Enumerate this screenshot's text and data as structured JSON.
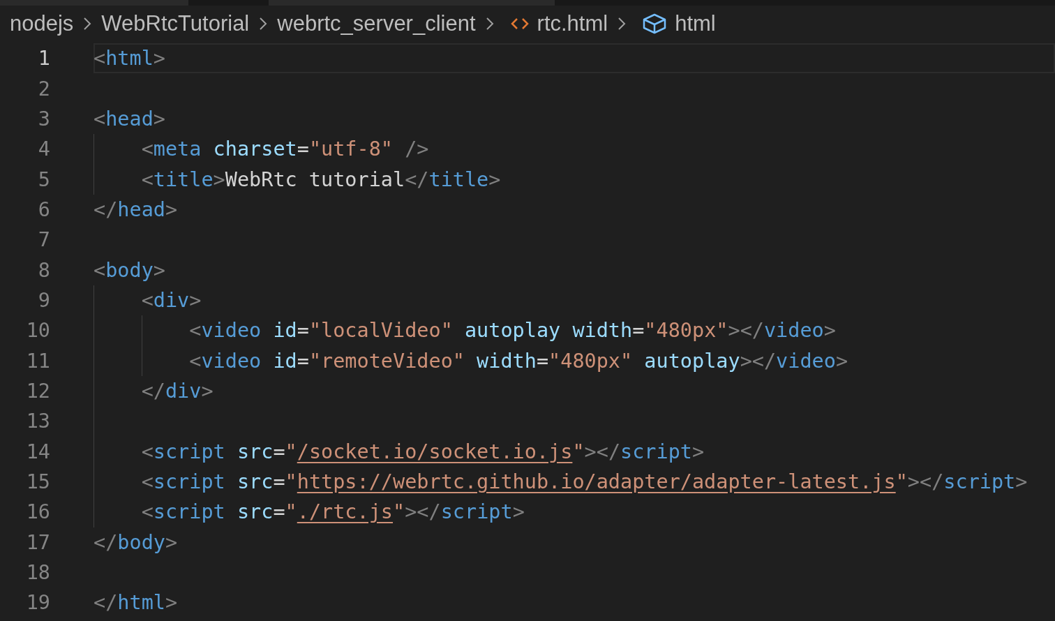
{
  "breadcrumbs": [
    {
      "kind": "folder",
      "label": "nodejs"
    },
    {
      "kind": "folder",
      "label": "WebRtcTutorial"
    },
    {
      "kind": "folder",
      "label": "webrtc_server_client"
    },
    {
      "kind": "file",
      "label": "rtc.html"
    },
    {
      "kind": "symbol",
      "label": "html"
    }
  ],
  "editor": {
    "lines": [
      {
        "number": "1",
        "current": true,
        "tokens": [
          {
            "kind": "punct",
            "text": "<"
          },
          {
            "kind": "tag",
            "text": "html"
          },
          {
            "kind": "punct",
            "text": ">"
          }
        ]
      },
      {
        "number": "2",
        "current": false
      },
      {
        "number": "3",
        "current": false,
        "tokens": [
          {
            "kind": "punct",
            "text": "<"
          },
          {
            "kind": "tag",
            "text": "head"
          },
          {
            "kind": "punct",
            "text": ">"
          }
        ]
      },
      {
        "number": "4",
        "current": false,
        "tokens": [
          {
            "kind": "punct",
            "text": "    <"
          },
          {
            "kind": "tag",
            "text": "meta"
          },
          {
            "kind": "attr",
            "text": " charset"
          },
          {
            "kind": "text",
            "text": "="
          },
          {
            "kind": "string",
            "text": "\"utf-8\""
          },
          {
            "kind": "punct",
            "text": " />"
          }
        ]
      },
      {
        "number": "5",
        "current": false,
        "tokens": [
          {
            "kind": "punct",
            "text": "    <"
          },
          {
            "kind": "tag",
            "text": "title"
          },
          {
            "kind": "punct",
            "text": ">"
          },
          {
            "kind": "text",
            "text": "WebRtc tutorial"
          },
          {
            "kind": "punct",
            "text": "</"
          },
          {
            "kind": "tag",
            "text": "title"
          },
          {
            "kind": "punct",
            "text": ">"
          }
        ]
      },
      {
        "number": "6",
        "current": false,
        "tokens": [
          {
            "kind": "punct",
            "text": "</"
          },
          {
            "kind": "tag",
            "text": "head"
          },
          {
            "kind": "punct",
            "text": ">"
          }
        ]
      },
      {
        "number": "7",
        "current": false
      },
      {
        "number": "8",
        "current": false,
        "tokens": [
          {
            "kind": "punct",
            "text": "<"
          },
          {
            "kind": "tag",
            "text": "body"
          },
          {
            "kind": "punct",
            "text": ">"
          }
        ]
      },
      {
        "number": "9",
        "current": false,
        "tokens": [
          {
            "kind": "punct",
            "text": "    <"
          },
          {
            "kind": "tag",
            "text": "div"
          },
          {
            "kind": "punct",
            "text": ">"
          }
        ]
      },
      {
        "number": "10",
        "current": false,
        "tokens": [
          {
            "kind": "punct",
            "text": "        <"
          },
          {
            "kind": "tag",
            "text": "video"
          },
          {
            "kind": "attr",
            "text": " id"
          },
          {
            "kind": "text",
            "text": "="
          },
          {
            "kind": "string",
            "text": "\"localVideo\""
          },
          {
            "kind": "attr",
            "text": " autoplay width"
          },
          {
            "kind": "text",
            "text": "="
          },
          {
            "kind": "string",
            "text": "\"480px\""
          },
          {
            "kind": "punct",
            "text": "></"
          },
          {
            "kind": "tag",
            "text": "video"
          },
          {
            "kind": "punct",
            "text": ">"
          }
        ]
      },
      {
        "number": "11",
        "current": false,
        "tokens": [
          {
            "kind": "punct",
            "text": "        <"
          },
          {
            "kind": "tag",
            "text": "video"
          },
          {
            "kind": "attr",
            "text": " id"
          },
          {
            "kind": "text",
            "text": "="
          },
          {
            "kind": "string",
            "text": "\"remoteVideo\""
          },
          {
            "kind": "attr",
            "text": " width"
          },
          {
            "kind": "text",
            "text": "="
          },
          {
            "kind": "string",
            "text": "\"480px\""
          },
          {
            "kind": "attr",
            "text": " autoplay"
          },
          {
            "kind": "punct",
            "text": "></"
          },
          {
            "kind": "tag",
            "text": "video"
          },
          {
            "kind": "punct",
            "text": ">"
          }
        ]
      },
      {
        "number": "12",
        "current": false,
        "tokens": [
          {
            "kind": "punct",
            "text": "    </"
          },
          {
            "kind": "tag",
            "text": "div"
          },
          {
            "kind": "punct",
            "text": ">"
          }
        ]
      },
      {
        "number": "13",
        "current": false
      },
      {
        "number": "14",
        "current": false,
        "tokens": [
          {
            "kind": "punct",
            "text": "    <"
          },
          {
            "kind": "tag",
            "text": "script"
          },
          {
            "kind": "attr",
            "text": " src"
          },
          {
            "kind": "text",
            "text": "="
          },
          {
            "kind": "string",
            "text": "\""
          },
          {
            "kind": "link",
            "text": "/socket.io/socket.io.js"
          },
          {
            "kind": "string",
            "text": "\""
          },
          {
            "kind": "punct",
            "text": "></"
          },
          {
            "kind": "tag",
            "text": "script"
          },
          {
            "kind": "punct",
            "text": ">"
          }
        ]
      },
      {
        "number": "15",
        "current": false,
        "tokens": [
          {
            "kind": "punct",
            "text": "    <"
          },
          {
            "kind": "tag",
            "text": "script"
          },
          {
            "kind": "attr",
            "text": " src"
          },
          {
            "kind": "text",
            "text": "="
          },
          {
            "kind": "string",
            "text": "\""
          },
          {
            "kind": "link",
            "text": "https://webrtc.github.io/adapter/adapter-latest.js"
          },
          {
            "kind": "string",
            "text": "\""
          },
          {
            "kind": "punct",
            "text": "></"
          },
          {
            "kind": "tag",
            "text": "script"
          },
          {
            "kind": "punct",
            "text": ">"
          }
        ]
      },
      {
        "number": "16",
        "current": false,
        "tokens": [
          {
            "kind": "punct",
            "text": "    <"
          },
          {
            "kind": "tag",
            "text": "script"
          },
          {
            "kind": "attr",
            "text": " src"
          },
          {
            "kind": "text",
            "text": "="
          },
          {
            "kind": "string",
            "text": "\""
          },
          {
            "kind": "link",
            "text": "./rtc.js"
          },
          {
            "kind": "string",
            "text": "\""
          },
          {
            "kind": "punct",
            "text": "></"
          },
          {
            "kind": "tag",
            "text": "script"
          },
          {
            "kind": "punct",
            "text": ">"
          }
        ]
      },
      {
        "number": "17",
        "current": false,
        "tokens": [
          {
            "kind": "punct",
            "text": "</"
          },
          {
            "kind": "tag",
            "text": "body"
          },
          {
            "kind": "punct",
            "text": ">"
          }
        ]
      },
      {
        "number": "18",
        "current": false
      },
      {
        "number": "19",
        "current": false,
        "tokens": [
          {
            "kind": "punct",
            "text": "</"
          },
          {
            "kind": "tag",
            "text": "html"
          },
          {
            "kind": "punct",
            "text": ">"
          }
        ]
      }
    ]
  }
}
